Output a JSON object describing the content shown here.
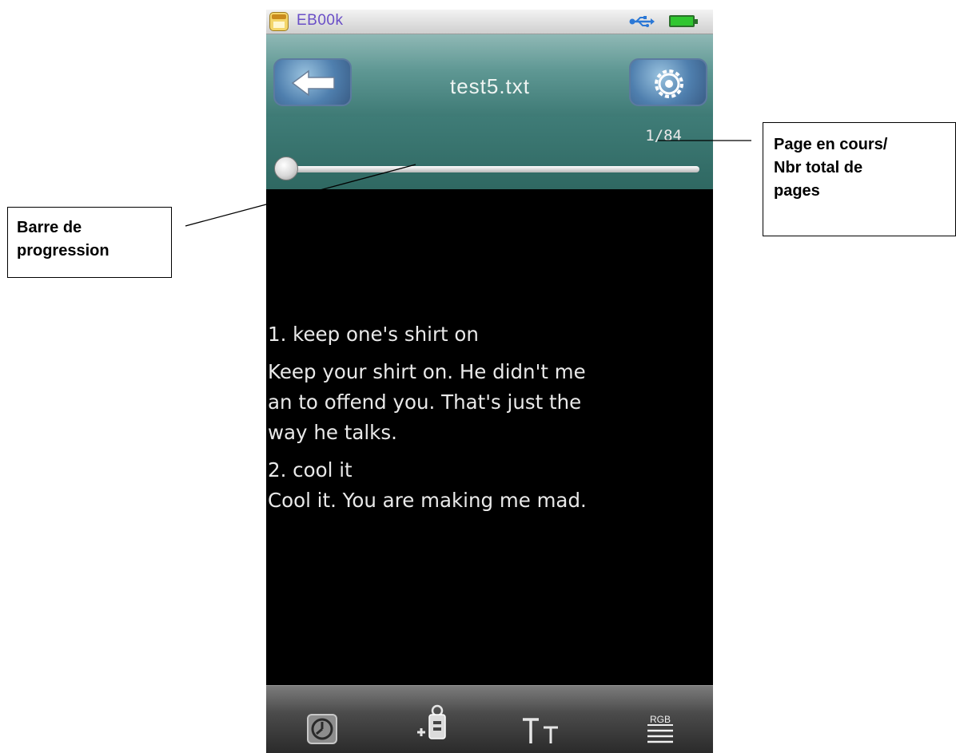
{
  "status_bar": {
    "app_name": "EB00k",
    "icons": {
      "app": "ebook-app-icon",
      "usb": "usb-icon",
      "battery": "battery-icon"
    }
  },
  "header": {
    "title": "test5.txt",
    "back_icon": "back-arrow-icon",
    "settings_icon": "gear-icon"
  },
  "progress": {
    "page_counter": "1/84",
    "current_page": 1,
    "total_pages": 84,
    "fraction": 0.0
  },
  "reader": {
    "lines": [
      "1. keep one's shirt on",
      "Keep your shirt on. He didn't me",
      "an to offend you. That's just the",
      "way he talks.",
      "2. cool it",
      "Cool it. You are making me mad."
    ]
  },
  "toolbar": {
    "icons": [
      "clock-icon",
      "add-bookmark-icon",
      "font-size-icon",
      "rgb-color-icon"
    ],
    "font_icon_text": "TT",
    "rgb_text": "RGB"
  },
  "annotations": {
    "left_label": [
      "Barre de",
      "progression"
    ],
    "right_label": [
      "Page en cours/",
      "Nbr total de",
      "pages"
    ]
  },
  "colors": {
    "header_teal": "#3e7a75",
    "app_name": "#6a4fc7",
    "reader_text": "#e9e9e9",
    "reader_bg": "#000000"
  }
}
